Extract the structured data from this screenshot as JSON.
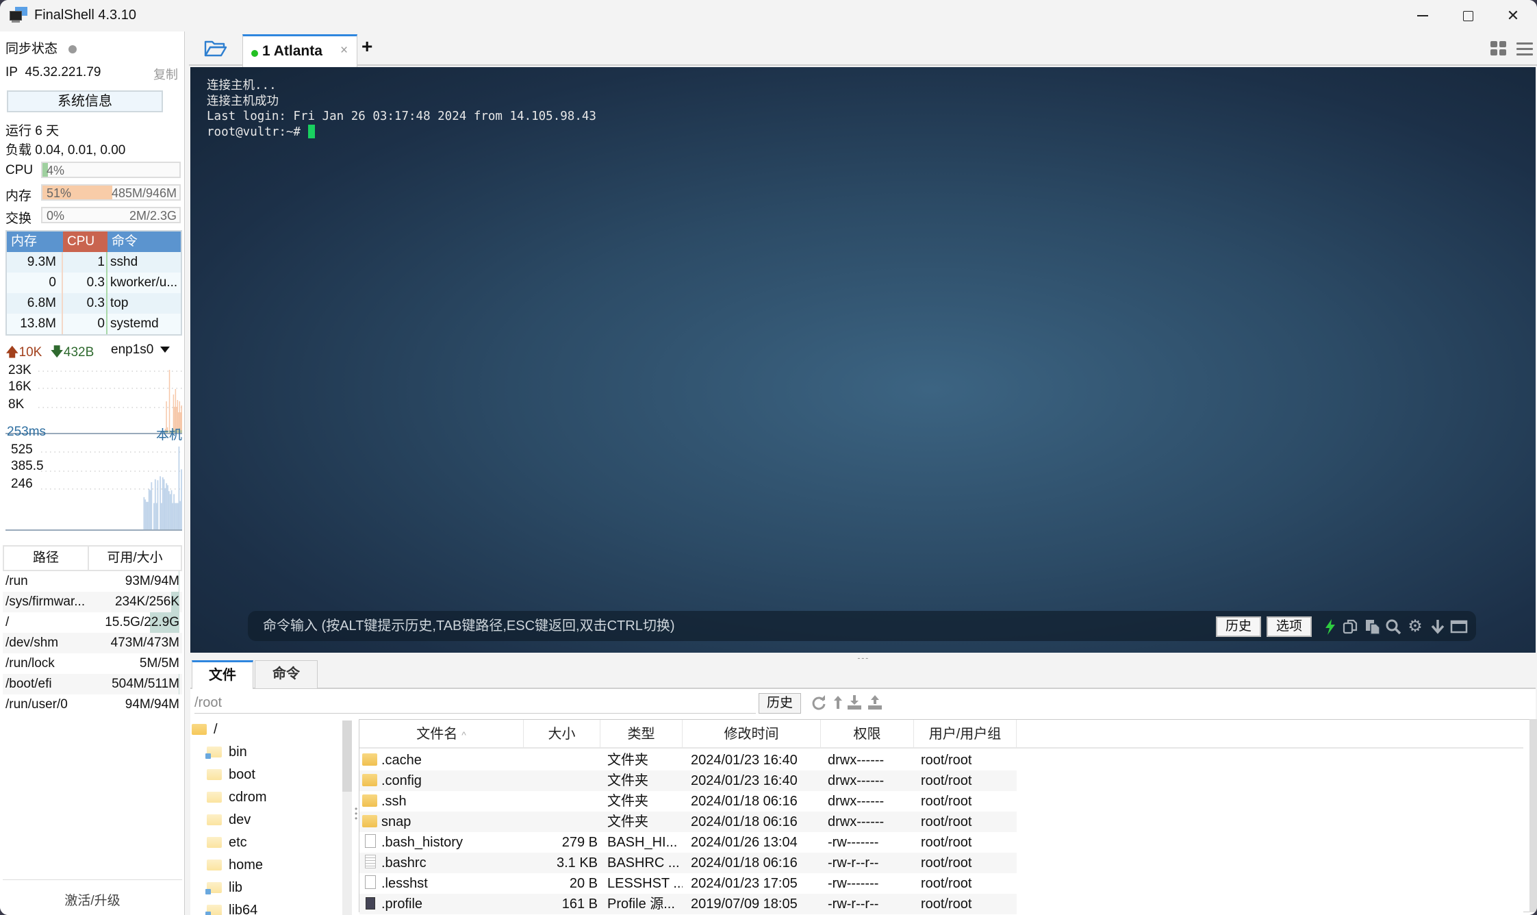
{
  "window": {
    "title": "FinalShell 4.3.10",
    "controls": {
      "minimize": "minimize",
      "maximize": "maximize",
      "close": "close"
    }
  },
  "sidebar": {
    "sync_status_label": "同步状态",
    "ip_label": "IP",
    "ip_value": "45.32.221.79",
    "copy_label": "复制",
    "sysinfo_button": "系统信息",
    "uptime": "运行 6 天",
    "load": "负载 0.04, 0.01, 0.00",
    "meters": {
      "cpu": {
        "label": "CPU",
        "percent_text": "4%",
        "fraction": 0.04,
        "amount": "",
        "color": "#9fd09f"
      },
      "mem": {
        "label": "内存",
        "percent_text": "51%",
        "fraction": 0.51,
        "amount": "485M/946M",
        "color": "#f8cca8"
      },
      "swap": {
        "label": "交换",
        "percent_text": "0%",
        "fraction": 0.0,
        "amount": "2M/2.3G",
        "color": "#cccccc"
      }
    },
    "process_table": {
      "headers": [
        "内存",
        "CPU",
        "命令"
      ],
      "rows": [
        {
          "mem": "9.3M",
          "cpu": "1",
          "cmd": "sshd"
        },
        {
          "mem": "0",
          "cpu": "0.3",
          "cmd": "kworker/u..."
        },
        {
          "mem": "6.8M",
          "cpu": "0.3",
          "cmd": "top"
        },
        {
          "mem": "13.8M",
          "cpu": "0",
          "cmd": "systemd"
        }
      ]
    },
    "network": {
      "upload": "10K",
      "download": "432B",
      "interface": "enp1s0",
      "y_labels": [
        "23K",
        "16K",
        "8K"
      ],
      "max": 23000,
      "upload_series": [
        0,
        0,
        0,
        0,
        0,
        0,
        0,
        0,
        0,
        0,
        0,
        0,
        0,
        0,
        0,
        0,
        0,
        0,
        0,
        0,
        0,
        0,
        0,
        0,
        0,
        0,
        0,
        0,
        0,
        0,
        0,
        0,
        0,
        0,
        0,
        0,
        0,
        0,
        0,
        0,
        0,
        0,
        0,
        0,
        0,
        0,
        0,
        0,
        0,
        0,
        0,
        0,
        0,
        0,
        0,
        0,
        0,
        0,
        0,
        0,
        0,
        0,
        0,
        0,
        0,
        0,
        0,
        0,
        0,
        0,
        0,
        0,
        0,
        0,
        0,
        0,
        0,
        0,
        0,
        0,
        0,
        0,
        0,
        0,
        0,
        0,
        0,
        0,
        0,
        0,
        0,
        0,
        0,
        0,
        0,
        0,
        0,
        0,
        0,
        0,
        0,
        0,
        0,
        0,
        0,
        0,
        0,
        0,
        0,
        0,
        0,
        0,
        0,
        0,
        0,
        0,
        0,
        0,
        0,
        0,
        0,
        0,
        0,
        0,
        0,
        1500,
        11500,
        2000,
        0,
        23000,
        800,
        600,
        1000,
        14000,
        9500,
        16000,
        9500,
        12000,
        7500,
        11500,
        7500,
        10000
      ],
      "download_series": [
        0,
        0,
        0,
        0,
        0,
        0,
        0,
        0,
        0,
        0,
        0,
        0,
        0,
        0,
        0,
        0,
        0,
        0,
        0,
        0,
        0,
        0,
        0,
        0,
        0,
        0,
        0,
        0,
        0,
        0,
        0,
        0,
        0,
        0,
        0,
        0,
        0,
        0,
        0,
        0,
        0,
        0,
        0,
        0,
        0,
        0,
        0,
        0,
        0,
        0,
        0,
        0,
        0,
        0,
        0,
        0,
        0,
        0,
        0,
        0,
        0,
        0,
        0,
        0,
        0,
        0,
        0,
        0,
        0,
        0,
        0,
        0,
        0,
        0,
        0,
        0,
        0,
        0,
        0,
        0,
        0,
        0,
        0,
        0,
        0,
        0,
        0,
        0,
        0,
        0,
        0,
        0,
        0,
        0,
        0,
        0,
        0,
        0,
        0,
        0,
        0,
        0,
        0,
        0,
        0,
        0,
        0,
        0,
        0,
        0,
        0,
        0,
        0,
        0,
        0,
        0,
        0,
        0,
        0,
        0,
        0,
        0,
        0,
        0,
        0,
        800,
        900,
        700,
        0,
        1000,
        700,
        600,
        700,
        1500,
        900,
        1000,
        800,
        1200,
        900,
        1800,
        900,
        1000
      ]
    },
    "latency": {
      "current": "253ms",
      "host_label": "本机",
      "y_labels": [
        "525",
        "385.5",
        "246"
      ],
      "min": 107,
      "max": 525,
      "series": [
        0,
        0,
        0,
        0,
        0,
        0,
        0,
        0,
        0,
        0,
        0,
        0,
        0,
        0,
        0,
        0,
        0,
        0,
        0,
        0,
        0,
        0,
        0,
        0,
        0,
        0,
        0,
        0,
        0,
        0,
        0,
        0,
        0,
        0,
        0,
        0,
        0,
        0,
        0,
        0,
        0,
        0,
        0,
        0,
        0,
        0,
        0,
        0,
        0,
        0,
        0,
        0,
        0,
        0,
        0,
        0,
        0,
        0,
        0,
        0,
        0,
        0,
        0,
        0,
        0,
        0,
        0,
        0,
        0,
        0,
        0,
        0,
        0,
        0,
        0,
        0,
        0,
        0,
        0,
        0,
        0,
        0,
        270,
        258,
        246,
        246,
        310,
        305,
        345,
        0,
        240,
        360,
        240,
        355,
        0,
        375,
        240,
        370,
        360,
        315,
        340,
        330,
        300,
        285,
        305,
        240,
        285,
        240,
        240,
        240,
        525,
        250,
        410
      ]
    },
    "disk_table": {
      "headers": [
        "路径",
        "可用/大小"
      ],
      "rows": [
        {
          "path": "/run",
          "size": "93M/94M",
          "used_fraction": 0.01
        },
        {
          "path": "/sys/firmwar...",
          "size": "234K/256K",
          "used_fraction": 0.09
        },
        {
          "path": "/",
          "size": "15.5G/22.9G",
          "used_fraction": 0.32
        },
        {
          "path": "/dev/shm",
          "size": "473M/473M",
          "used_fraction": 0.0
        },
        {
          "path": "/run/lock",
          "size": "5M/5M",
          "used_fraction": 0.0
        },
        {
          "path": "/boot/efi",
          "size": "504M/511M",
          "used_fraction": 0.01
        },
        {
          "path": "/run/user/0",
          "size": "94M/94M",
          "used_fraction": 0.0
        }
      ]
    },
    "activate_label": "激活/升级"
  },
  "tabs": {
    "items": [
      {
        "label": "1 Atlanta",
        "status": "connected",
        "active": true
      }
    ],
    "close_glyph": "×",
    "new_tab_glyph": "+"
  },
  "terminal": {
    "lines": [
      "连接主机...",
      "连接主机成功",
      "Last login: Fri Jan 26 03:17:48 2024 from 14.105.98.43"
    ],
    "prompt": "root@vultr:~# ",
    "command_placeholder": "命令输入 (按ALT键提示历史,TAB键路径,ESC键返回,双击CTRL切换)",
    "history_button": "历史",
    "options_button": "选项",
    "icons": [
      "lightning-icon",
      "copy-icon",
      "paste-icon",
      "search-icon",
      "gear-icon",
      "download-icon",
      "maximize-icon"
    ]
  },
  "bottom_panel": {
    "tabs": [
      {
        "label": "文件",
        "active": true
      },
      {
        "label": "命令",
        "active": false
      }
    ],
    "path_value": "/root",
    "history_button": "历史",
    "toolbar_icons": [
      "refresh-icon",
      "up-dir-icon",
      "download-icon",
      "upload-icon"
    ],
    "tree": [
      {
        "name": "/",
        "level": 0,
        "link": false
      },
      {
        "name": "bin",
        "level": 1,
        "link": true
      },
      {
        "name": "boot",
        "level": 1,
        "link": false
      },
      {
        "name": "cdrom",
        "level": 1,
        "link": false
      },
      {
        "name": "dev",
        "level": 1,
        "link": false
      },
      {
        "name": "etc",
        "level": 1,
        "link": false
      },
      {
        "name": "home",
        "level": 1,
        "link": false
      },
      {
        "name": "lib",
        "level": 1,
        "link": true
      },
      {
        "name": "lib64",
        "level": 1,
        "link": true
      }
    ],
    "file_table": {
      "headers": [
        "文件名",
        "大小",
        "类型",
        "修改时间",
        "权限",
        "用户/用户组"
      ],
      "sort_indicator": "^",
      "rows": [
        {
          "icon": "folder",
          "name": ".cache",
          "size": "",
          "type": "文件夹",
          "mtime": "2024/01/23 16:40",
          "perm": "drwx------",
          "owner": "root/root"
        },
        {
          "icon": "folder",
          "name": ".config",
          "size": "",
          "type": "文件夹",
          "mtime": "2024/01/23 16:40",
          "perm": "drwx------",
          "owner": "root/root"
        },
        {
          "icon": "folder",
          "name": ".ssh",
          "size": "",
          "type": "文件夹",
          "mtime": "2024/01/18 06:16",
          "perm": "drwx------",
          "owner": "root/root"
        },
        {
          "icon": "folder",
          "name": "snap",
          "size": "",
          "type": "文件夹",
          "mtime": "2024/01/18 06:16",
          "perm": "drwx------",
          "owner": "root/root"
        },
        {
          "icon": "doc",
          "name": ".bash_history",
          "size": "279 B",
          "type": "BASH_HI...",
          "mtime": "2024/01/26 13:04",
          "perm": "-rw-------",
          "owner": "root/root"
        },
        {
          "icon": "text",
          "name": ".bashrc",
          "size": "3.1 KB",
          "type": "BASHRC ...",
          "mtime": "2024/01/18 06:16",
          "perm": "-rw-r--r--",
          "owner": "root/root"
        },
        {
          "icon": "doc",
          "name": ".lesshst",
          "size": "20 B",
          "type": "LESSHST ...",
          "mtime": "2024/01/23 17:05",
          "perm": "-rw-------",
          "owner": "root/root"
        },
        {
          "icon": "dark",
          "name": ".profile",
          "size": "161 B",
          "type": "Profile 源...",
          "mtime": "2019/07/09 18:05",
          "perm": "-rw-r--r--",
          "owner": "root/root"
        }
      ]
    }
  }
}
